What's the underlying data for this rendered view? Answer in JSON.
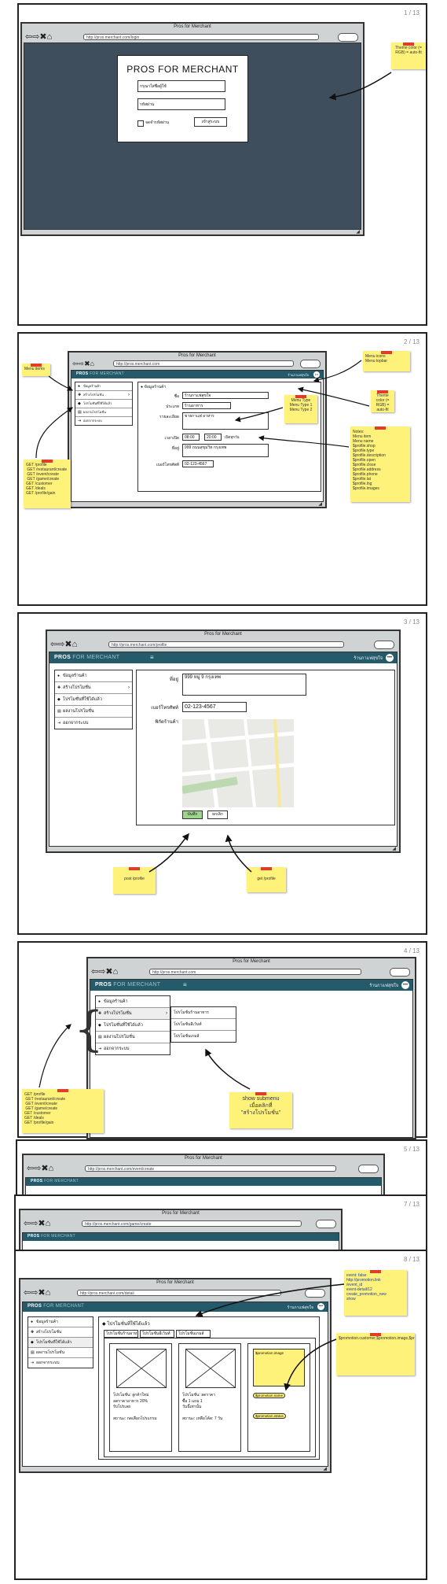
{
  "page_numbers": [
    "1 / 13",
    "2 / 13",
    "3 / 13",
    "4 / 13",
    "5 / 13",
    "7 / 13",
    "8 / 13"
  ],
  "browser": {
    "title": "Pros for Merchant",
    "nav_glyphs": "⇦⇨✖⌂",
    "urls": {
      "login": "http://pros.merchant.com/login",
      "profile": "http://pros.merchant.com",
      "profile_p3": "http://pros.merchant.com/profile",
      "menu": "http://pros.merchant.com",
      "ex5": "http://pros.merchant.com/event/create",
      "ex6": "http://pros.merchant.com/game/create",
      "deals": "http://pros.merchant.com/detail"
    }
  },
  "app": {
    "brand_a": "PROS",
    "brand_b": "FOR MERCHANT",
    "user_label": "ร้านกาแฟสุขใจ",
    "user_icon": "user-icon"
  },
  "login": {
    "title": "PROS FOR MERCHANT",
    "username_placeholder": "กรุณาใส่ชื่อผู้ใช้",
    "password_placeholder": "รหัสผ่าน",
    "remember_label": "จดจำรหัสผ่าน",
    "login_button": "เข้าสู่ระบบ",
    "note": "Theme color (= RGB) = auto-fit"
  },
  "menu_items": [
    {
      "icon": "info-icon",
      "label": "ข้อมูลร้านค้า"
    },
    {
      "icon": "plus-icon",
      "label": "สร้างโปรโมชั่น",
      "has_sub": true
    },
    {
      "icon": "tag-icon",
      "label": "โปรโมชั่นที่ใช้ได้แล้ว"
    },
    {
      "icon": "doc-icon",
      "label": "ผลงานโปรโมชั่น"
    },
    {
      "icon": "logout-icon",
      "label": "ออกจากระบบ"
    }
  ],
  "profile": {
    "header": "ข้อมูลร้านค้า",
    "fields": [
      {
        "label": "ชื่อ",
        "value": "ร้านกาแฟสุขใจ"
      },
      {
        "label": "ประเภท",
        "value": "ร้านอาหาร"
      },
      {
        "label": "รายละเอียด",
        "value": "ขายกาแฟ อาหาร"
      },
      {
        "label": "เวลาเปิด",
        "value": "08:00 - 20:00"
      },
      {
        "label": "ที่อยู่",
        "value": "999 ถนนสุขุมวิท กรุงเทพ"
      },
      {
        "label": "เบอร์โทรศัพท์",
        "value": "02-123-4567"
      }
    ],
    "hours_open": "08:00",
    "hours_close": "20:00",
    "hours_suffix": "เปิดทุกวัน",
    "address_p3": "999 หมู่ 9 กรุงเทพ",
    "phone_p3": "02-123-4567",
    "map_label": "พิกัดร้านค้า",
    "save_button": "บันทึก",
    "cancel_button": "ยกเลิก"
  },
  "notes": {
    "p2_left": "Menu items",
    "p2_api": "GET /profile\n GET /restaurant/create\n GET /event/create\n GET /game/create\nGET /customer\nGET /deals\nGET /profile/gain",
    "p2_menu_icons": "Menu icons\nMenu topbar",
    "p2_themecolor": "Theme color (= RGB) = auto-fit",
    "p2_types": "Menu Type\nMenu Type 1\nMenu Type 2",
    "p2_list": "Notes:\nMenu item\nMenu name\n$profile.shop\n$profile.type\n$profile.description\n$profile.open\n$profile.close\n$profile.address\n$profile.phone\n$profile.lat\n$profile.lng\n$profile.images",
    "p3_post": "post /profile",
    "p3_get": "get /profile",
    "p4_api": "GET /profile\n GET /restaurant/create\n GET /event/create\n GET /game/create\nGET /customer\nGET /deals\nGET /profile/gain",
    "p4_show": "show submenu\nเมื่อคลิกที่\n\"สร้างโปรโมชั่น\"",
    "p8_note1": "event: false\nhttp://promotion.link\n/event_id\nevent-detail/12\ncreate_promotion_new\nshow",
    "p8_note2": "$promotion.customer,$promotion.image,$promotion.subscription,$promotion.end"
  },
  "submenu": [
    "โปรโมชั่นร้านอาหาร",
    "โปรโมชั่นอีเว้นท์",
    "โปรโมชั่นเกมส์"
  ],
  "deals": {
    "header": "โปรโมชั่นที่ใช้ได้แล้ว",
    "tabs": [
      "โปรโมชั่นร้านอาหาร",
      "โปรโมชั่นอีเว้นท์",
      "โปรโมชั่นเกมส์"
    ],
    "cards": [
      {
        "title": "โปรโมชั่น: ลูกค้าใหม่",
        "desc": "ลดราคาอาหาร 20%\nรับโปรเลย",
        "foot": "สถานะ: กดเลือกโปรแกรม"
      },
      {
        "title": "โปรโมชั่น: ลดราคา",
        "desc": "ซื้อ 1 แถม 1\nวันนี้เท่านั้น",
        "foot": "สถานะ: เหลือโค้ด: 7 วัน"
      },
      {
        "title": "$promotion.image",
        "desc": "$promotion.name",
        "foot": "$promotion.status"
      }
    ]
  },
  "colors": {
    "dark": "#3e4e5c",
    "topbar": "#245a6a",
    "sticky": "#fff27a",
    "pin": "#e03b2f"
  }
}
